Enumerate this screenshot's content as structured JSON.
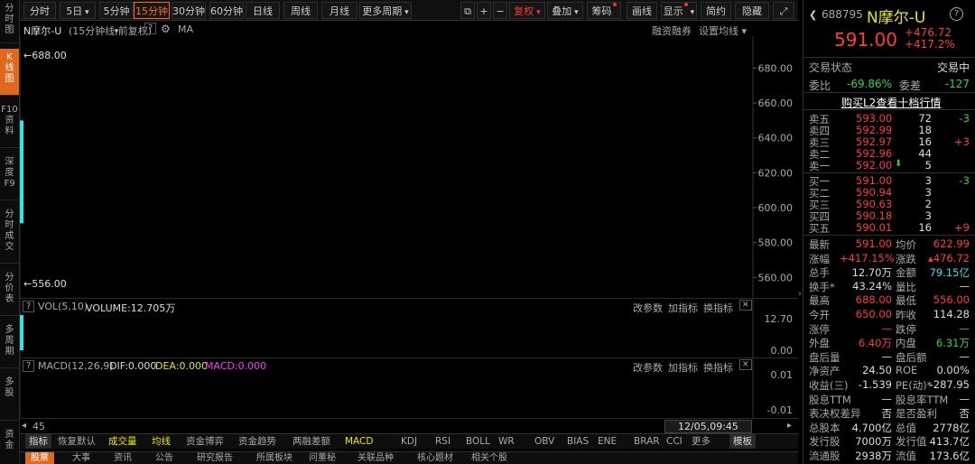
{
  "left_nav": [
    {
      "label": "分\n时\n图",
      "active": false
    },
    {
      "label": "K\n线\n图",
      "active": true
    },
    {
      "label": "F10\n资\n料",
      "active": false
    },
    {
      "label": "深\n度\nF9",
      "active": false
    },
    {
      "label": "分\n时\n成\n交",
      "active": false
    },
    {
      "label": "分\n价\n表",
      "active": false
    },
    {
      "label": "多\n周\n期",
      "active": false
    },
    {
      "label": "多\n股",
      "active": false
    },
    {
      "label": "资\n金",
      "active": false
    }
  ],
  "toolbar": {
    "periods": [
      "分时",
      "5日",
      "5分钟",
      "15分钟",
      "30分钟",
      "60分钟",
      "日线",
      "周线",
      "月线",
      "更多周期"
    ],
    "active_period": "15分钟",
    "dropdown_arrow": "▾",
    "icons": [
      "⧉",
      "+",
      "−"
    ],
    "restore_rights": "复权",
    "overlay": "叠加",
    "chips": "筹码",
    "draw": "画线",
    "display": "显示",
    "simple": "简约",
    "hide": "隐藏"
  },
  "chart_header": {
    "name": "N摩尔-U",
    "desc": "(15分钟线,前复权)",
    "help": "?",
    "ma": "MA",
    "financing": "融资融券",
    "set_ma": "设置均线"
  },
  "chart_data": {
    "type": "line",
    "period": "15分钟",
    "y_ticks": [
      "680.00",
      "660.00",
      "640.00",
      "620.00",
      "600.00",
      "580.00",
      "560.00"
    ],
    "ylim": [
      556,
      688
    ],
    "high_label": "688.00",
    "low_label": "556.00",
    "candles": [
      {
        "high": 688.0,
        "low": 556.0,
        "open": 650.0,
        "close": 591.0
      }
    ],
    "volume": {
      "title": "VOL(5,10)",
      "value_label": "VOLUME:12.705万",
      "y_ticks": [
        "12.70",
        "0.00"
      ],
      "values": [
        12.705
      ]
    },
    "macd": {
      "title": "MACD(12,26,9)",
      "dif": "DIF:0.000",
      "dea": "DEA:0.000",
      "macd": "MACD:0.000",
      "y_ticks": [
        "0.01",
        "-0.01"
      ]
    },
    "x_count": "45",
    "x_time": "12/05,09:45"
  },
  "indicator_panels": {
    "change_params": "改参数",
    "add_indicator": "加指标",
    "switch_indicator": "换指标",
    "close": "✕"
  },
  "bottom_tabs": [
    "指标",
    "恢复默认",
    "成交量",
    "均线",
    "资金博弈",
    "资金趋势",
    "两融差额",
    "MACD",
    "KDJ",
    "RSI",
    "BOLL",
    "WR",
    "OBV",
    "BIAS",
    "ENE",
    "BRAR",
    "CCI",
    "更多",
    "模板"
  ],
  "bottom_tabs2": [
    "股票",
    "大事",
    "资讯",
    "公告",
    "研究报告",
    "所属板块",
    "问董秘",
    "关联品种",
    "核心题材",
    "相关个股"
  ],
  "right_panel": {
    "code": "688795",
    "name": "N摩尔-U",
    "price": "591.00",
    "change": "+476.72",
    "change_pct": "+417.2%",
    "trade_status_label": "交易状态",
    "trade_status": "交易中",
    "weibi_label": "委比",
    "weibi": "-69.86%",
    "weicha_label": "委差",
    "weicha": "-127",
    "l2_link": "购买L2查看十档行情",
    "asks": [
      {
        "label": "卖五",
        "price": "593.00",
        "vol": "72",
        "chg": "-3"
      },
      {
        "label": "卖四",
        "price": "592.99",
        "vol": "18",
        "chg": ""
      },
      {
        "label": "卖三",
        "price": "592.97",
        "vol": "16",
        "chg": "+3"
      },
      {
        "label": "卖二",
        "price": "592.96",
        "vol": "44",
        "chg": ""
      },
      {
        "label": "卖一",
        "price": "592.00",
        "vol": "5",
        "chg": "",
        "arrow": "⬇"
      }
    ],
    "bids": [
      {
        "label": "买一",
        "price": "591.00",
        "vol": "3",
        "chg": "-3"
      },
      {
        "label": "买二",
        "price": "590.94",
        "vol": "3",
        "chg": ""
      },
      {
        "label": "买三",
        "price": "590.63",
        "vol": "2",
        "chg": ""
      },
      {
        "label": "买四",
        "price": "590.18",
        "vol": "3",
        "chg": ""
      },
      {
        "label": "买五",
        "price": "590.01",
        "vol": "16",
        "chg": "+9"
      }
    ],
    "stats": [
      {
        "l1": "最新",
        "v1": "591.00",
        "c1": "red",
        "l2": "均价",
        "v2": "622.99",
        "c2": "red"
      },
      {
        "l1": "涨幅",
        "v1": "+417.15%",
        "c1": "red",
        "l2": "涨跌",
        "v2": "▴476.72",
        "c2": "red"
      },
      {
        "l1": "总手",
        "v1": "12.70万",
        "c1": "white",
        "l2": "金额",
        "v2": "79.15亿",
        "c2": "cyan"
      },
      {
        "l1": "换手*",
        "v1": "43.24%",
        "c1": "white",
        "l2": "量比",
        "v2": "—",
        "c2": "white"
      },
      {
        "l1": "最高",
        "v1": "688.00",
        "c1": "red",
        "l2": "最低",
        "v2": "556.00",
        "c2": "red"
      },
      {
        "l1": "今开",
        "v1": "650.00",
        "c1": "red",
        "l2": "昨收",
        "v2": "114.28",
        "c2": "white"
      },
      {
        "l1": "涨停",
        "v1": "—",
        "c1": "red",
        "l2": "跌停",
        "v2": "—",
        "c2": "green"
      },
      {
        "l1": "外盘",
        "v1": "6.40万",
        "c1": "red",
        "l2": "内盘",
        "v2": "6.31万",
        "c2": "green"
      },
      {
        "l1": "盘后量",
        "v1": "—",
        "c1": "white",
        "l2": "盘后额",
        "v2": "—",
        "c2": "white"
      },
      {
        "l1": "净资产",
        "v1": "24.50",
        "c1": "white",
        "l2": "ROE",
        "v2": "0.00%",
        "c2": "white"
      },
      {
        "l1": "收益(三)",
        "v1": "-1.539",
        "c1": "white",
        "l2": "PE(动)*",
        "v2": "-287.95",
        "c2": "white"
      },
      {
        "l1": "股息TTM",
        "v1": "—",
        "c1": "white",
        "l2": "股息率TTM",
        "v2": "—",
        "c2": "white"
      },
      {
        "l1": "表决权差异",
        "v1": "否",
        "c1": "white",
        "l2": "是否盈利",
        "v2": "否",
        "c2": "white"
      },
      {
        "l1": "总股本",
        "v1": "4.700亿",
        "c1": "white",
        "l2": "总值",
        "v2": "2778亿",
        "c2": "white"
      },
      {
        "l1": "发行股",
        "v1": "7000万",
        "c1": "white",
        "l2": "发行值",
        "v2": "413.7亿",
        "c2": "white"
      },
      {
        "l1": "流通股",
        "v1": "2938万",
        "c1": "white",
        "l2": "流值",
        "v2": "173.6亿",
        "c2": "white"
      }
    ]
  }
}
